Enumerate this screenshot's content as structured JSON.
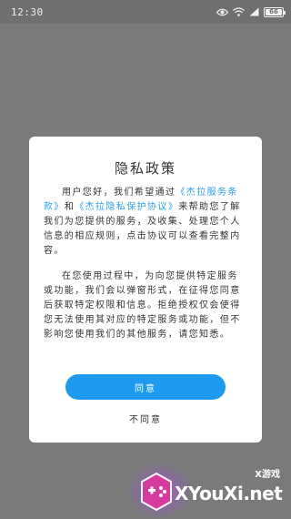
{
  "status_bar": {
    "time": "12:30",
    "battery": "66",
    "icons": [
      "eye-icon",
      "wifi-icon",
      "signal-icon",
      "battery-icon"
    ]
  },
  "modal": {
    "title": "隐私政策",
    "paragraph1": {
      "text_before": "用户您好，我们希望通过",
      "link1": "《杰拉服务条款》",
      "text_mid": "和",
      "link2": "《杰拉隐私保护协议》",
      "text_after": "来帮助您了解我们为您提供的服务，及收集、处理您个人信息的相应规则，点击协议可以查看完整内容。"
    },
    "paragraph2": "在您使用过程中，为向您提供特定服务或功能，我们会以弹窗形式，在征得您同意后获取特定权限和信息。拒绝授权仅会使得您无法使用其对应的特定服务或功能，但不影响您使用我们的其他服务，请您知悉。",
    "agree_label": "同意",
    "disagree_label": "不同意"
  },
  "watermark": {
    "tag": "X游戏",
    "text": "XYouXi.net"
  },
  "colors": {
    "accent": "#1e9bee",
    "link": "#2d9ee8",
    "overlay": "#7a7a7a"
  }
}
